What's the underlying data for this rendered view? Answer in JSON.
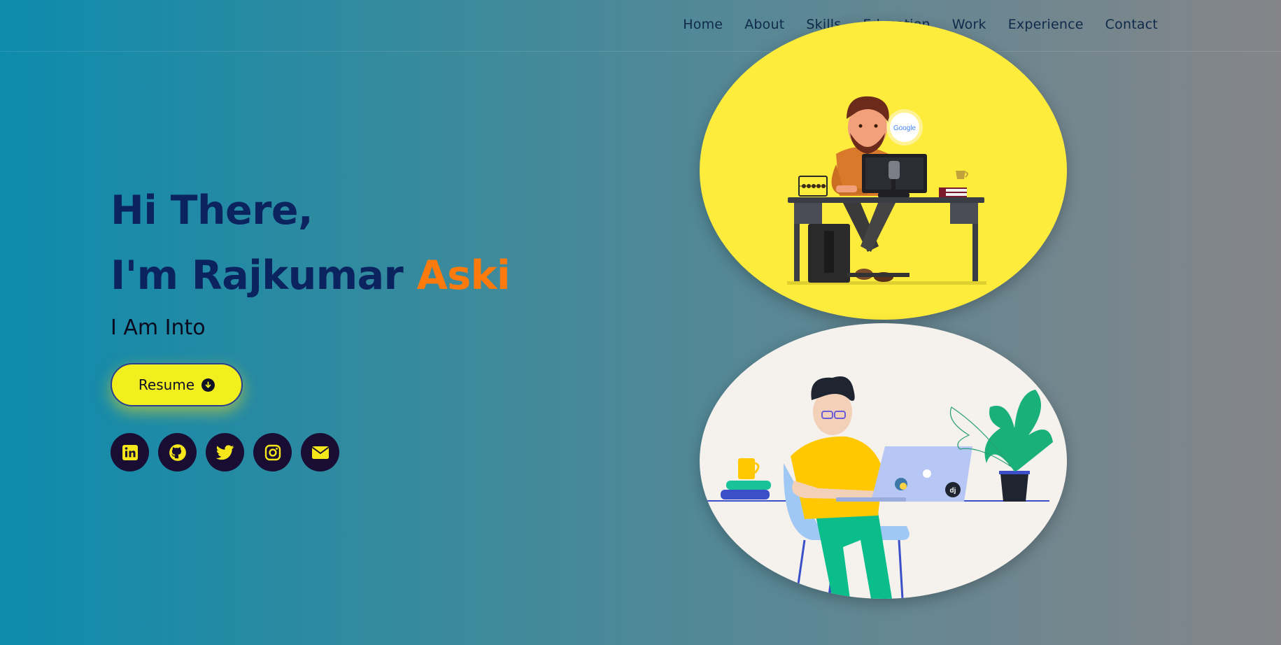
{
  "nav": {
    "items": [
      "Home",
      "About",
      "Skills",
      "Education",
      "Work",
      "Experience",
      "Contact"
    ]
  },
  "hero": {
    "line1": "Hi There,",
    "line2_prefix": "I'm Rajkumar ",
    "line2_accent": "Aski",
    "subtitle": "I Am Into",
    "resume_label": "Resume"
  },
  "socials": [
    "linkedin-icon",
    "github-icon",
    "twitter-icon",
    "instagram-icon",
    "envelope-icon"
  ],
  "illustrations": {
    "top_badge": "Google",
    "bottom_badge": "dj"
  },
  "colors": {
    "heading": "#0b2460",
    "accent": "#ff7a0c",
    "button": "#f2ef1e",
    "social_bg": "#1a0d33",
    "social_icon": "#f6e71a"
  }
}
